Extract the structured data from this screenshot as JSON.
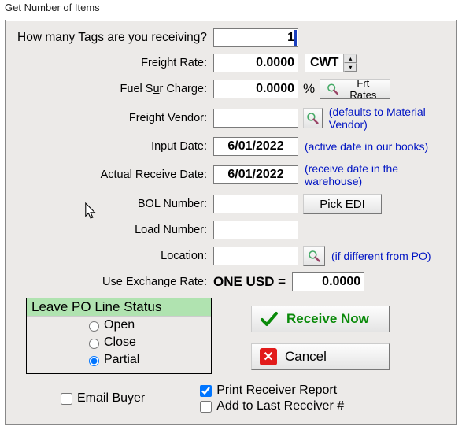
{
  "window_title": "Get Number of Items",
  "prompt": "How many Tags are you receiving?",
  "tags_value": "1",
  "labels": {
    "freight_rate": "Freight Rate:",
    "fuel_surcharge": "Fuel Sur Charge:",
    "freight_vendor": "Freight Vendor:",
    "input_date": "Input Date:",
    "actual_receive_date": "Actual Receive Date:",
    "bol_number": "BOL Number:",
    "load_number": "Load Number:",
    "location": "Location:",
    "use_exchange_rate": "Use Exchange Rate:"
  },
  "values": {
    "freight_rate": "0.0000",
    "freight_unit": "CWT",
    "fuel_surcharge": "0.0000",
    "fuel_unit": "%",
    "freight_vendor": "",
    "input_date": "6/01/2022",
    "actual_receive_date": "6/01/2022",
    "bol_number": "",
    "load_number": "",
    "location": "",
    "exchange_base": "ONE USD  =",
    "exchange_rate": "0.0000"
  },
  "buttons": {
    "frt_rates": "Frt Rates",
    "pick_edi": "Pick EDI",
    "receive_now": "Receive Now",
    "cancel": "Cancel"
  },
  "hints": {
    "freight_vendor": "(defaults to Material Vendor)",
    "input_date": "(active date in our books)",
    "actual_receive_date": "(receive date in the warehouse)",
    "location": "(if different from PO)"
  },
  "group": {
    "legend": "Leave PO Line Status",
    "options": {
      "open": "Open",
      "close": "Close",
      "partial": "Partial"
    },
    "selected": "partial"
  },
  "checks": {
    "email_buyer": "Email Buyer",
    "print_receiver": "Print Receiver Report",
    "add_to_last": "Add to Last Receiver #",
    "print_checked": true
  }
}
